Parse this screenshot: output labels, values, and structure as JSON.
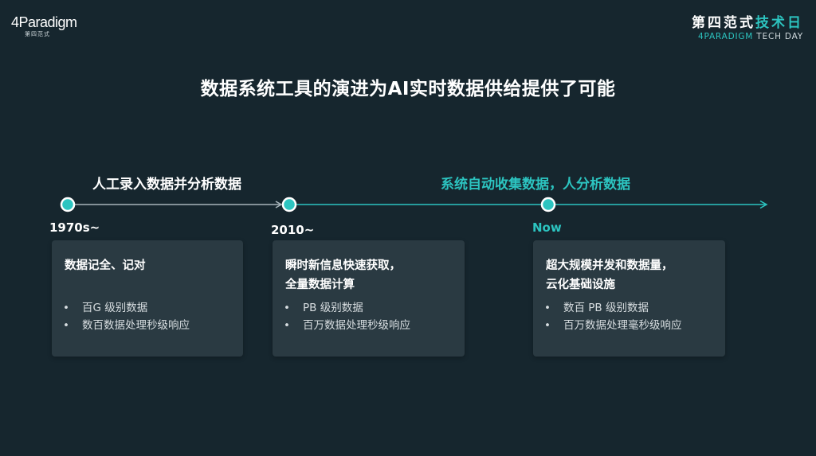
{
  "logo": {
    "mark": "4Paradigm",
    "sub": "第四范式"
  },
  "event": {
    "title_plain": "第四范式",
    "title_accent": "技术日",
    "sub_accent": "4PARADIGM",
    "sub_plain": " TECH DAY"
  },
  "title": "数据系统工具的演进为AI实时数据供给提供了可能",
  "phases": [
    {
      "label": "人工录入数据并分析数据"
    },
    {
      "label": "系统自动收集数据，人分析数据"
    }
  ],
  "eras": [
    "1970s~",
    "2010~",
    "Now"
  ],
  "cards": [
    {
      "title_lines": [
        "数据记全、记对"
      ],
      "bullets": [
        "百G 级别数据",
        "数百数据处理秒级响应"
      ]
    },
    {
      "title_lines": [
        "瞬时新信息快速获取，",
        "全量数据计算"
      ],
      "bullets": [
        "PB 级别数据",
        "百万数据处理秒级响应"
      ]
    },
    {
      "title_lines": [
        "超大规模并发和数据量，",
        "云化基础设施"
      ],
      "bullets": [
        "数百 PB 级别数据",
        "百万数据处理毫秒级响应"
      ]
    }
  ],
  "bullet_char": "•",
  "colors": {
    "background": "#16262e",
    "accent": "#2cc4c0",
    "card": "#2a3a42"
  }
}
